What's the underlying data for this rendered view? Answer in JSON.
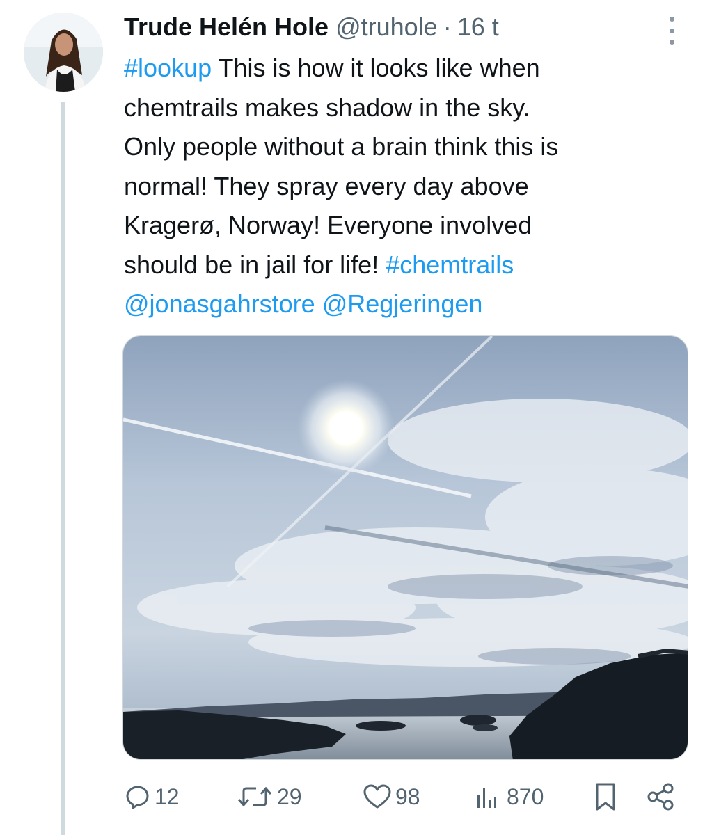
{
  "tweet": {
    "author_name": "Trude Helén Hole",
    "handle": "@truhole",
    "separator": "·",
    "time": "16 t",
    "text_lines": [
      {
        "hashtag": "#lookup",
        "rest": " This is how it looks like when"
      },
      "chemtrails makes shadow in the sky.",
      "Only people without a brain think this is",
      "normal! They spray every day above",
      "Kragerø, Norway! Everyone involved",
      {
        "text": "should be in jail for life! ",
        "hashtag": "#chemtrails"
      },
      {
        "mention1": "@jonasgahrstore",
        "space": " ",
        "mention2": "@Regjeringen"
      }
    ]
  },
  "actions": {
    "replies": "12",
    "retweets": "29",
    "likes": "98",
    "views": "870"
  },
  "colors": {
    "link": "#1d9bf0",
    "secondary": "#536471",
    "thread_line": "#cfd9de"
  }
}
